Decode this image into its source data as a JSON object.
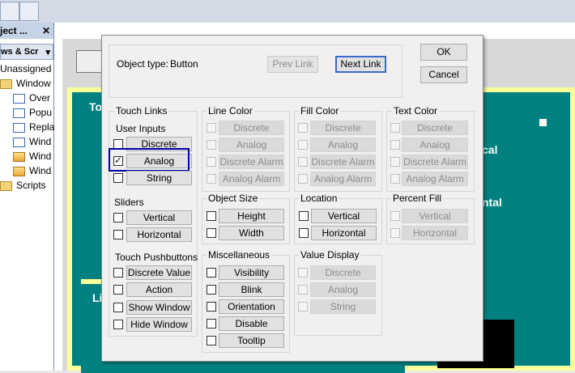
{
  "background": {
    "panel_title": "ject ...",
    "panel_close": "✕",
    "panel_sub": "ws & Scr",
    "tree": [
      "Unassigned",
      "Window",
      "Over",
      "Popu",
      "Repla",
      "Wind",
      "Wind",
      "Wind",
      "Scripts"
    ],
    "teal_texts": [
      "To",
      "cal",
      "ntal",
      "Li"
    ],
    "colors": {
      "teal": "#008080",
      "yellow_border": "#fdfd9a"
    }
  },
  "dialog": {
    "object_type_label": "Object type:",
    "object_type_value": "Button",
    "prev_link": "Prev Link",
    "next_link": "Next Link",
    "ok": "OK",
    "cancel": "Cancel",
    "touch_links": {
      "title": "Touch Links",
      "user_inputs": {
        "title": "User Inputs",
        "items": [
          {
            "label": "Discrete",
            "checked": false,
            "enabled": true
          },
          {
            "label": "Analog",
            "checked": true,
            "enabled": true
          },
          {
            "label": "String",
            "checked": false,
            "enabled": true
          }
        ]
      },
      "sliders": {
        "title": "Sliders",
        "items": [
          {
            "label": "Vertical",
            "checked": false,
            "enabled": true
          },
          {
            "label": "Horizontal",
            "checked": false,
            "enabled": true
          }
        ]
      },
      "touch_pushbuttons": {
        "title": "Touch Pushbuttons",
        "items": [
          {
            "label": "Discrete Value",
            "checked": false,
            "enabled": true
          },
          {
            "label": "Action",
            "checked": false,
            "enabled": true
          },
          {
            "label": "Show Window",
            "checked": false,
            "enabled": true
          },
          {
            "label": "Hide Window",
            "checked": false,
            "enabled": true
          }
        ]
      }
    },
    "line_color": {
      "title": "Line Color",
      "items": [
        "Discrete",
        "Analog",
        "Discrete Alarm",
        "Analog Alarm"
      ]
    },
    "fill_color": {
      "title": "Fill Color",
      "items": [
        "Discrete",
        "Analog",
        "Discrete Alarm",
        "Analog Alarm"
      ]
    },
    "text_color": {
      "title": "Text Color",
      "items": [
        "Discrete",
        "Analog",
        "Discrete Alarm",
        "Analog Alarm"
      ]
    },
    "object_size": {
      "title": "Object Size",
      "items": [
        "Height",
        "Width"
      ]
    },
    "location": {
      "title": "Location",
      "items": [
        "Vertical",
        "Horizontal"
      ]
    },
    "percent_fill": {
      "title": "Percent Fill",
      "items": [
        "Vertical",
        "Horizontal"
      ]
    },
    "miscellaneous": {
      "title": "Miscellaneous",
      "items": [
        "Visibility",
        "Blink",
        "Orientation",
        "Disable",
        "Tooltip"
      ]
    },
    "value_display": {
      "title": "Value Display",
      "items": [
        "Discrete",
        "Analog",
        "String"
      ]
    }
  }
}
